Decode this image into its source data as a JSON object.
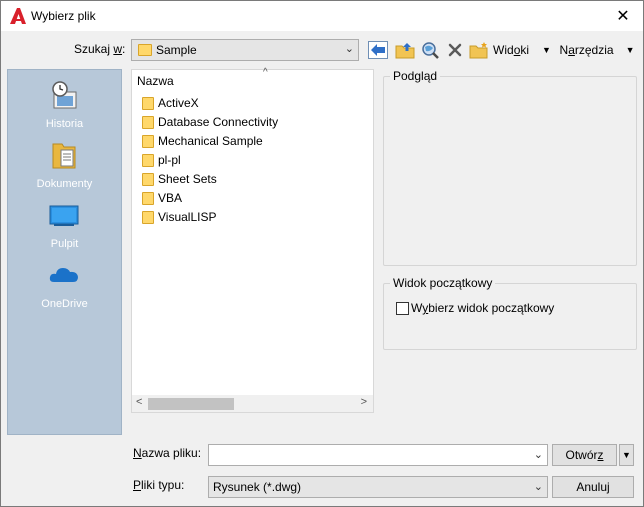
{
  "window": {
    "title": "Wybierz plik",
    "close_glyph": "✕"
  },
  "lookin": {
    "label_main": "Szukaj ",
    "label_ul": "w",
    "label_end": ":",
    "value": "Sample"
  },
  "toolbar": {
    "views_pre": "Wid",
    "views_ul": "o",
    "views_post": "ki",
    "tools_pre": "N",
    "tools_ul": "a",
    "tools_post": "rzędzia"
  },
  "places": [
    {
      "label": "Historia",
      "icon": "history-icon"
    },
    {
      "label": "Dokumenty",
      "icon": "documents-icon"
    },
    {
      "label": "Pulpit",
      "icon": "desktop-icon"
    },
    {
      "label": "OneDrive",
      "icon": "cloud-icon"
    }
  ],
  "filelist": {
    "column_header": "Nazwa",
    "items": [
      "ActiveX",
      "Database Connectivity",
      "Mechanical Sample",
      "pl-pl",
      "Sheet Sets",
      "VBA",
      "VisualLISP"
    ]
  },
  "preview": {
    "title": "Podgląd"
  },
  "initial_view": {
    "title": "Widok początkowy",
    "checkbox_pre": "W",
    "checkbox_ul": "y",
    "checkbox_post": "bierz widok początkowy",
    "checked": false
  },
  "filename": {
    "label_pre": "",
    "label_ul": "N",
    "label_post": "azwa pliku:",
    "value": ""
  },
  "filetype": {
    "label_pre": "",
    "label_ul": "P",
    "label_post": "liki typu:",
    "value": "Rysunek (*.dwg)"
  },
  "buttons": {
    "open_pre": "Otwór",
    "open_ul": "z",
    "cancel": "Anuluj"
  },
  "colors": {
    "places_bg": "#b7c8d9",
    "autocad_red": "#d9202b"
  }
}
